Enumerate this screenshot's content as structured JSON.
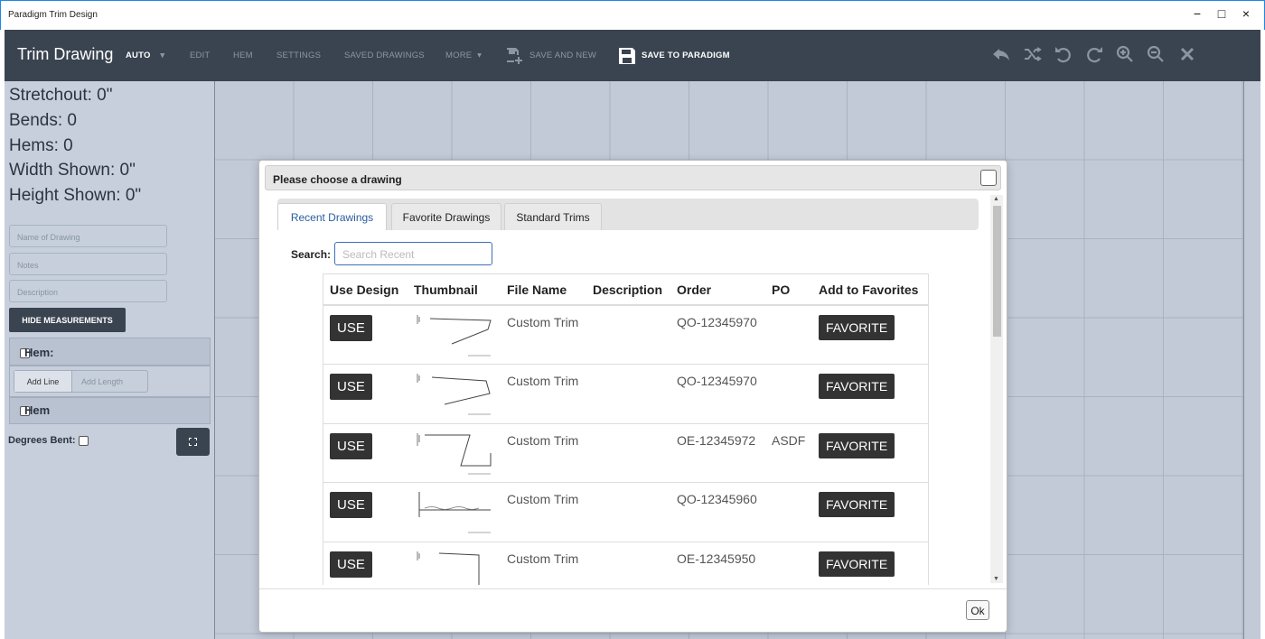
{
  "window": {
    "title": "Paradigm Trim Design",
    "minimize": "−",
    "maximize": "□",
    "close": "×"
  },
  "toolbar": {
    "brand": "Trim Drawing",
    "auto": "AUTO",
    "auto_caret": "▾",
    "edit": "EDIT",
    "hem": "HEM",
    "settings": "SETTINGS",
    "saved_drawings": "SAVED DRAWINGS",
    "more": "MORE",
    "more_caret": "▾",
    "save_and_new": "SAVE AND NEW",
    "save_to_paradigm": "SAVE TO PARADIGM",
    "icons": [
      "reply-icon",
      "shuffle-icon",
      "undo-icon",
      "redo-icon",
      "zoom-in-icon",
      "zoom-out-icon",
      "close-icon"
    ]
  },
  "left_panel": {
    "stretchout": "Stretchout: 0\"",
    "bends": "Bends: 0",
    "hems": "Hems: 0",
    "width_shown": "Width Shown: 0\"",
    "height_shown": "Height Shown: 0\"",
    "name_placeholder": "Name of Drawing",
    "notes_placeholder": "Notes",
    "description_placeholder": "Description",
    "hide_measurements": "HIDE MEASUREMENTS",
    "hem_label": "Hem:",
    "add_line": "Add Line",
    "add_length_placeholder": "Add Length",
    "hem2_label": "Hem",
    "degrees_bent": "Degrees Bent:"
  },
  "modal": {
    "title": "Please choose a drawing",
    "tabs": [
      "Recent Drawings",
      "Favorite Drawings",
      "Standard Trims"
    ],
    "search_label": "Search:",
    "search_placeholder": "Search Recent",
    "columns": [
      "Use Design",
      "Thumbnail",
      "File Name",
      "Description",
      "Order",
      "PO",
      "Add to Favorites"
    ],
    "rows": [
      {
        "use": "USE",
        "file_name": "Custom Trim",
        "description": "",
        "order": "QO-12345970",
        "po": "",
        "favorite": "FAVORITE"
      },
      {
        "use": "USE",
        "file_name": "Custom Trim",
        "description": "",
        "order": "QO-12345970",
        "po": "",
        "favorite": "FAVORITE"
      },
      {
        "use": "USE",
        "file_name": "Custom Trim",
        "description": "",
        "order": "OE-12345972",
        "po": "ASDF",
        "favorite": "FAVORITE"
      },
      {
        "use": "USE",
        "file_name": "Custom Trim",
        "description": "",
        "order": "QO-12345960",
        "po": "",
        "favorite": "FAVORITE"
      },
      {
        "use": "USE",
        "file_name": "Custom Trim",
        "description": "",
        "order": "OE-12345950",
        "po": "",
        "favorite": "FAVORITE"
      }
    ],
    "ok": "Ok"
  }
}
